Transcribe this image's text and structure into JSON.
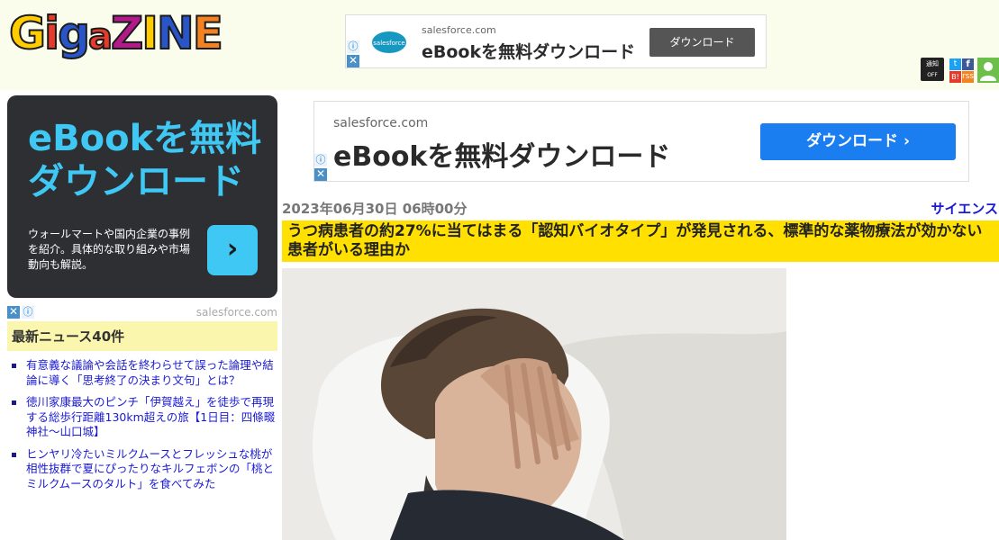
{
  "site": {
    "logo_text": "GIGAZINE"
  },
  "top_ad": {
    "domain": "salesforce.com",
    "title": "eBookを無料ダウンロード",
    "button": "ダウンロード",
    "logo_text": "salesforce"
  },
  "social": {
    "notice": "通知",
    "notice_sub": "OFF",
    "twitter": "t",
    "facebook": "f",
    "hatena": "B!",
    "rss": "rss"
  },
  "side_ad": {
    "headline": "eBookを無料ダウンロード",
    "description": "ウォールマートや国内企業の事例を紹介。具体的な取り組みや市場動向も解説。",
    "arrow": "›",
    "domain": "salesforce.com"
  },
  "latest": {
    "heading": "最新ニュース40件",
    "items": [
      "有意義な議論や会話を終わらせて誤った論理や結論に導く「思考終了の決まり文句」とは？",
      "徳川家康最大のピンチ「伊賀越え」を徒歩で再現する総歩行距離130km超えの旅【1日目：四條畷神社〜山口城】",
      "ヒンヤリ冷たいミルクムースとフレッシュな桃が相性抜群で夏にぴったりなキルフェボンの「桃とミルクムースのタルト」を食べてみた"
    ]
  },
  "main_ad": {
    "domain": "salesforce.com",
    "title": "eBookを無料ダウンロード",
    "button": "ダウンロード ›"
  },
  "article": {
    "date": "2023年06月30日 06時00分",
    "category": "サイエンス",
    "title": "うつ病患者の約27%に当てはまる「認知バイオタイプ」が発見される、標準的な薬物療法が効かない患者がいる理由か"
  },
  "adchoices": {
    "info": "ⓘ",
    "close": "✕"
  }
}
